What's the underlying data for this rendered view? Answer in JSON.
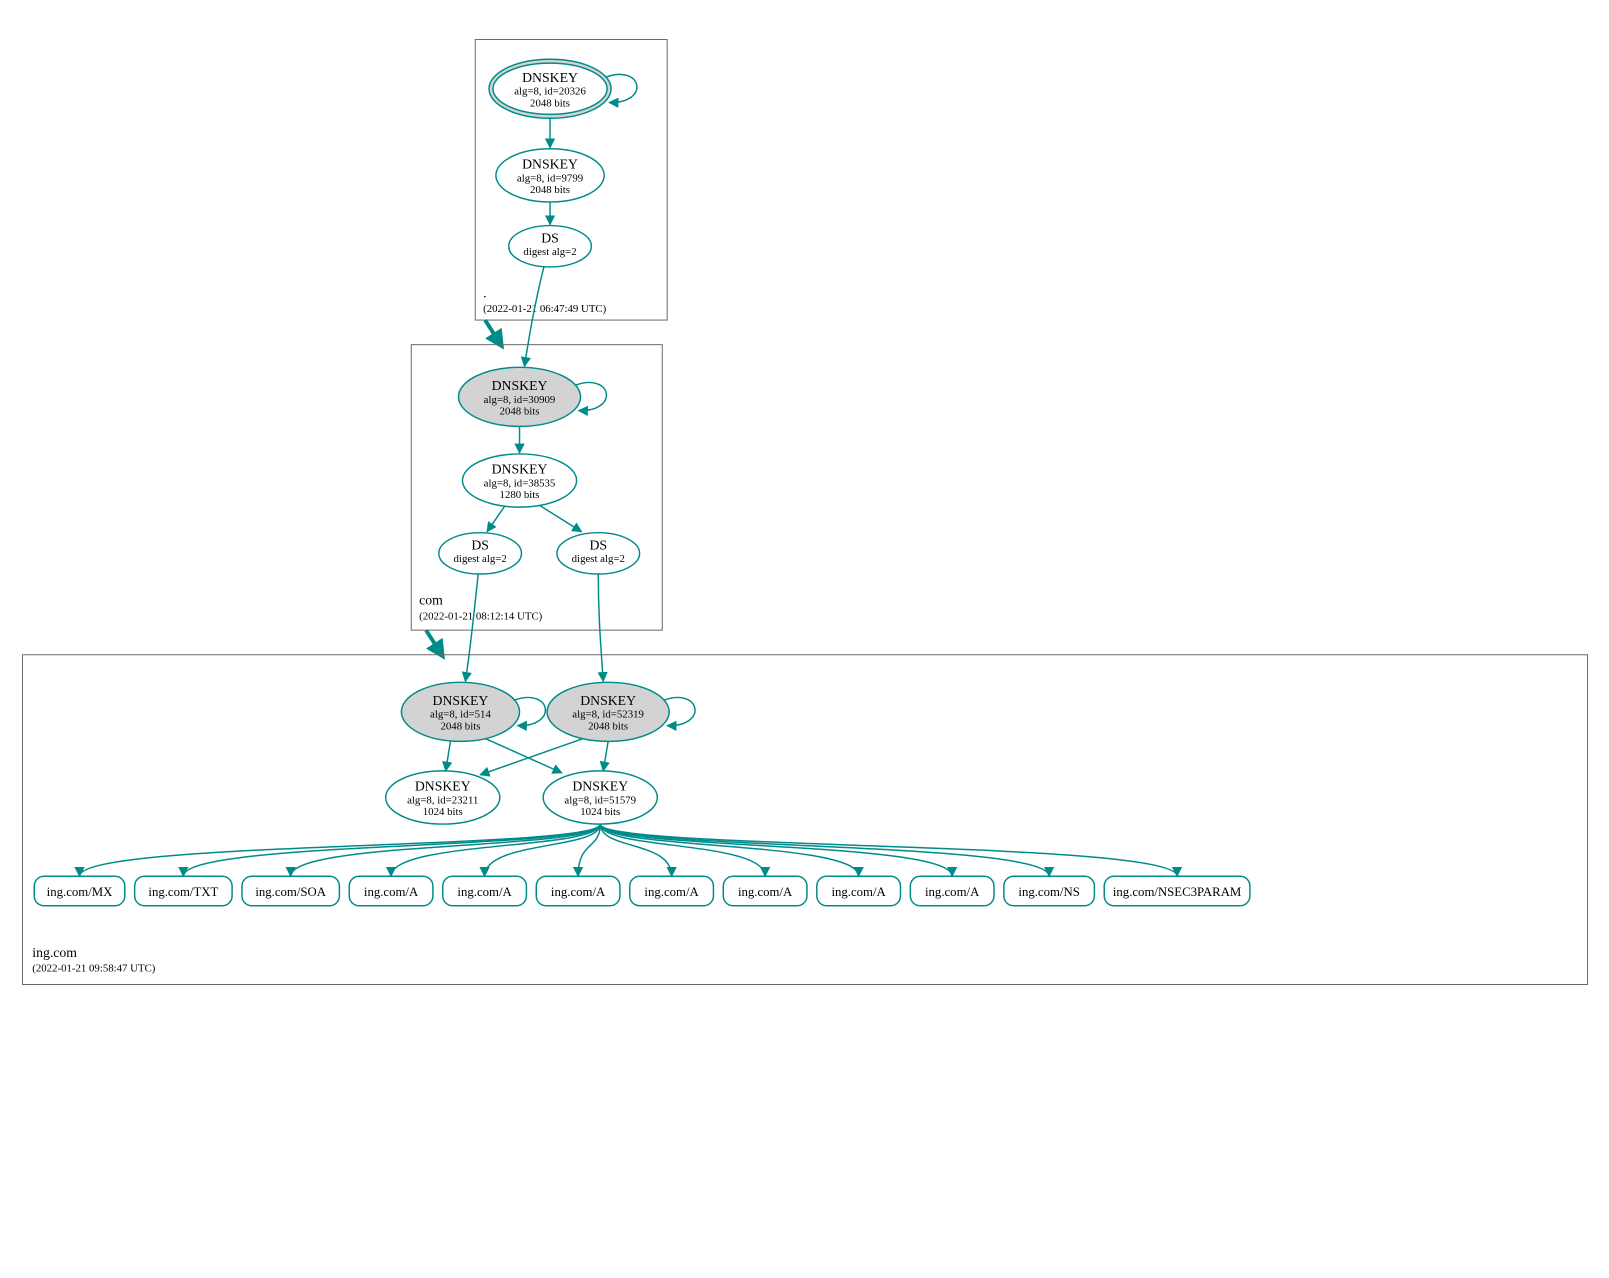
{
  "zones": {
    "root": {
      "name": ".",
      "timestamp": "(2022-01-21 06:47:49 UTC)",
      "ksk": {
        "title": "DNSKEY",
        "line1": "alg=8, id=20326",
        "line2": "2048 bits"
      },
      "zsk": {
        "title": "DNSKEY",
        "line1": "alg=8, id=9799",
        "line2": "2048 bits"
      },
      "ds": {
        "title": "DS",
        "line1": "digest alg=2"
      }
    },
    "com": {
      "name": "com",
      "timestamp": "(2022-01-21 08:12:14 UTC)",
      "ksk": {
        "title": "DNSKEY",
        "line1": "alg=8, id=30909",
        "line2": "2048 bits"
      },
      "zsk": {
        "title": "DNSKEY",
        "line1": "alg=8, id=38535",
        "line2": "1280 bits"
      },
      "ds1": {
        "title": "DS",
        "line1": "digest alg=2"
      },
      "ds2": {
        "title": "DS",
        "line1": "digest alg=2"
      }
    },
    "ing": {
      "name": "ing.com",
      "timestamp": "(2022-01-21 09:58:47 UTC)",
      "ksk1": {
        "title": "DNSKEY",
        "line1": "alg=8, id=514",
        "line2": "2048 bits"
      },
      "ksk2": {
        "title": "DNSKEY",
        "line1": "alg=8, id=52319",
        "line2": "2048 bits"
      },
      "zsk1": {
        "title": "DNSKEY",
        "line1": "alg=8, id=23211",
        "line2": "1024 bits"
      },
      "zsk2": {
        "title": "DNSKEY",
        "line1": "alg=8, id=51579",
        "line2": "1024 bits"
      },
      "rr": [
        "ing.com/MX",
        "ing.com/TXT",
        "ing.com/SOA",
        "ing.com/A",
        "ing.com/A",
        "ing.com/A",
        "ing.com/A",
        "ing.com/A",
        "ing.com/A",
        "ing.com/A",
        "ing.com/NS",
        "ing.com/NSEC3PARAM"
      ]
    }
  }
}
